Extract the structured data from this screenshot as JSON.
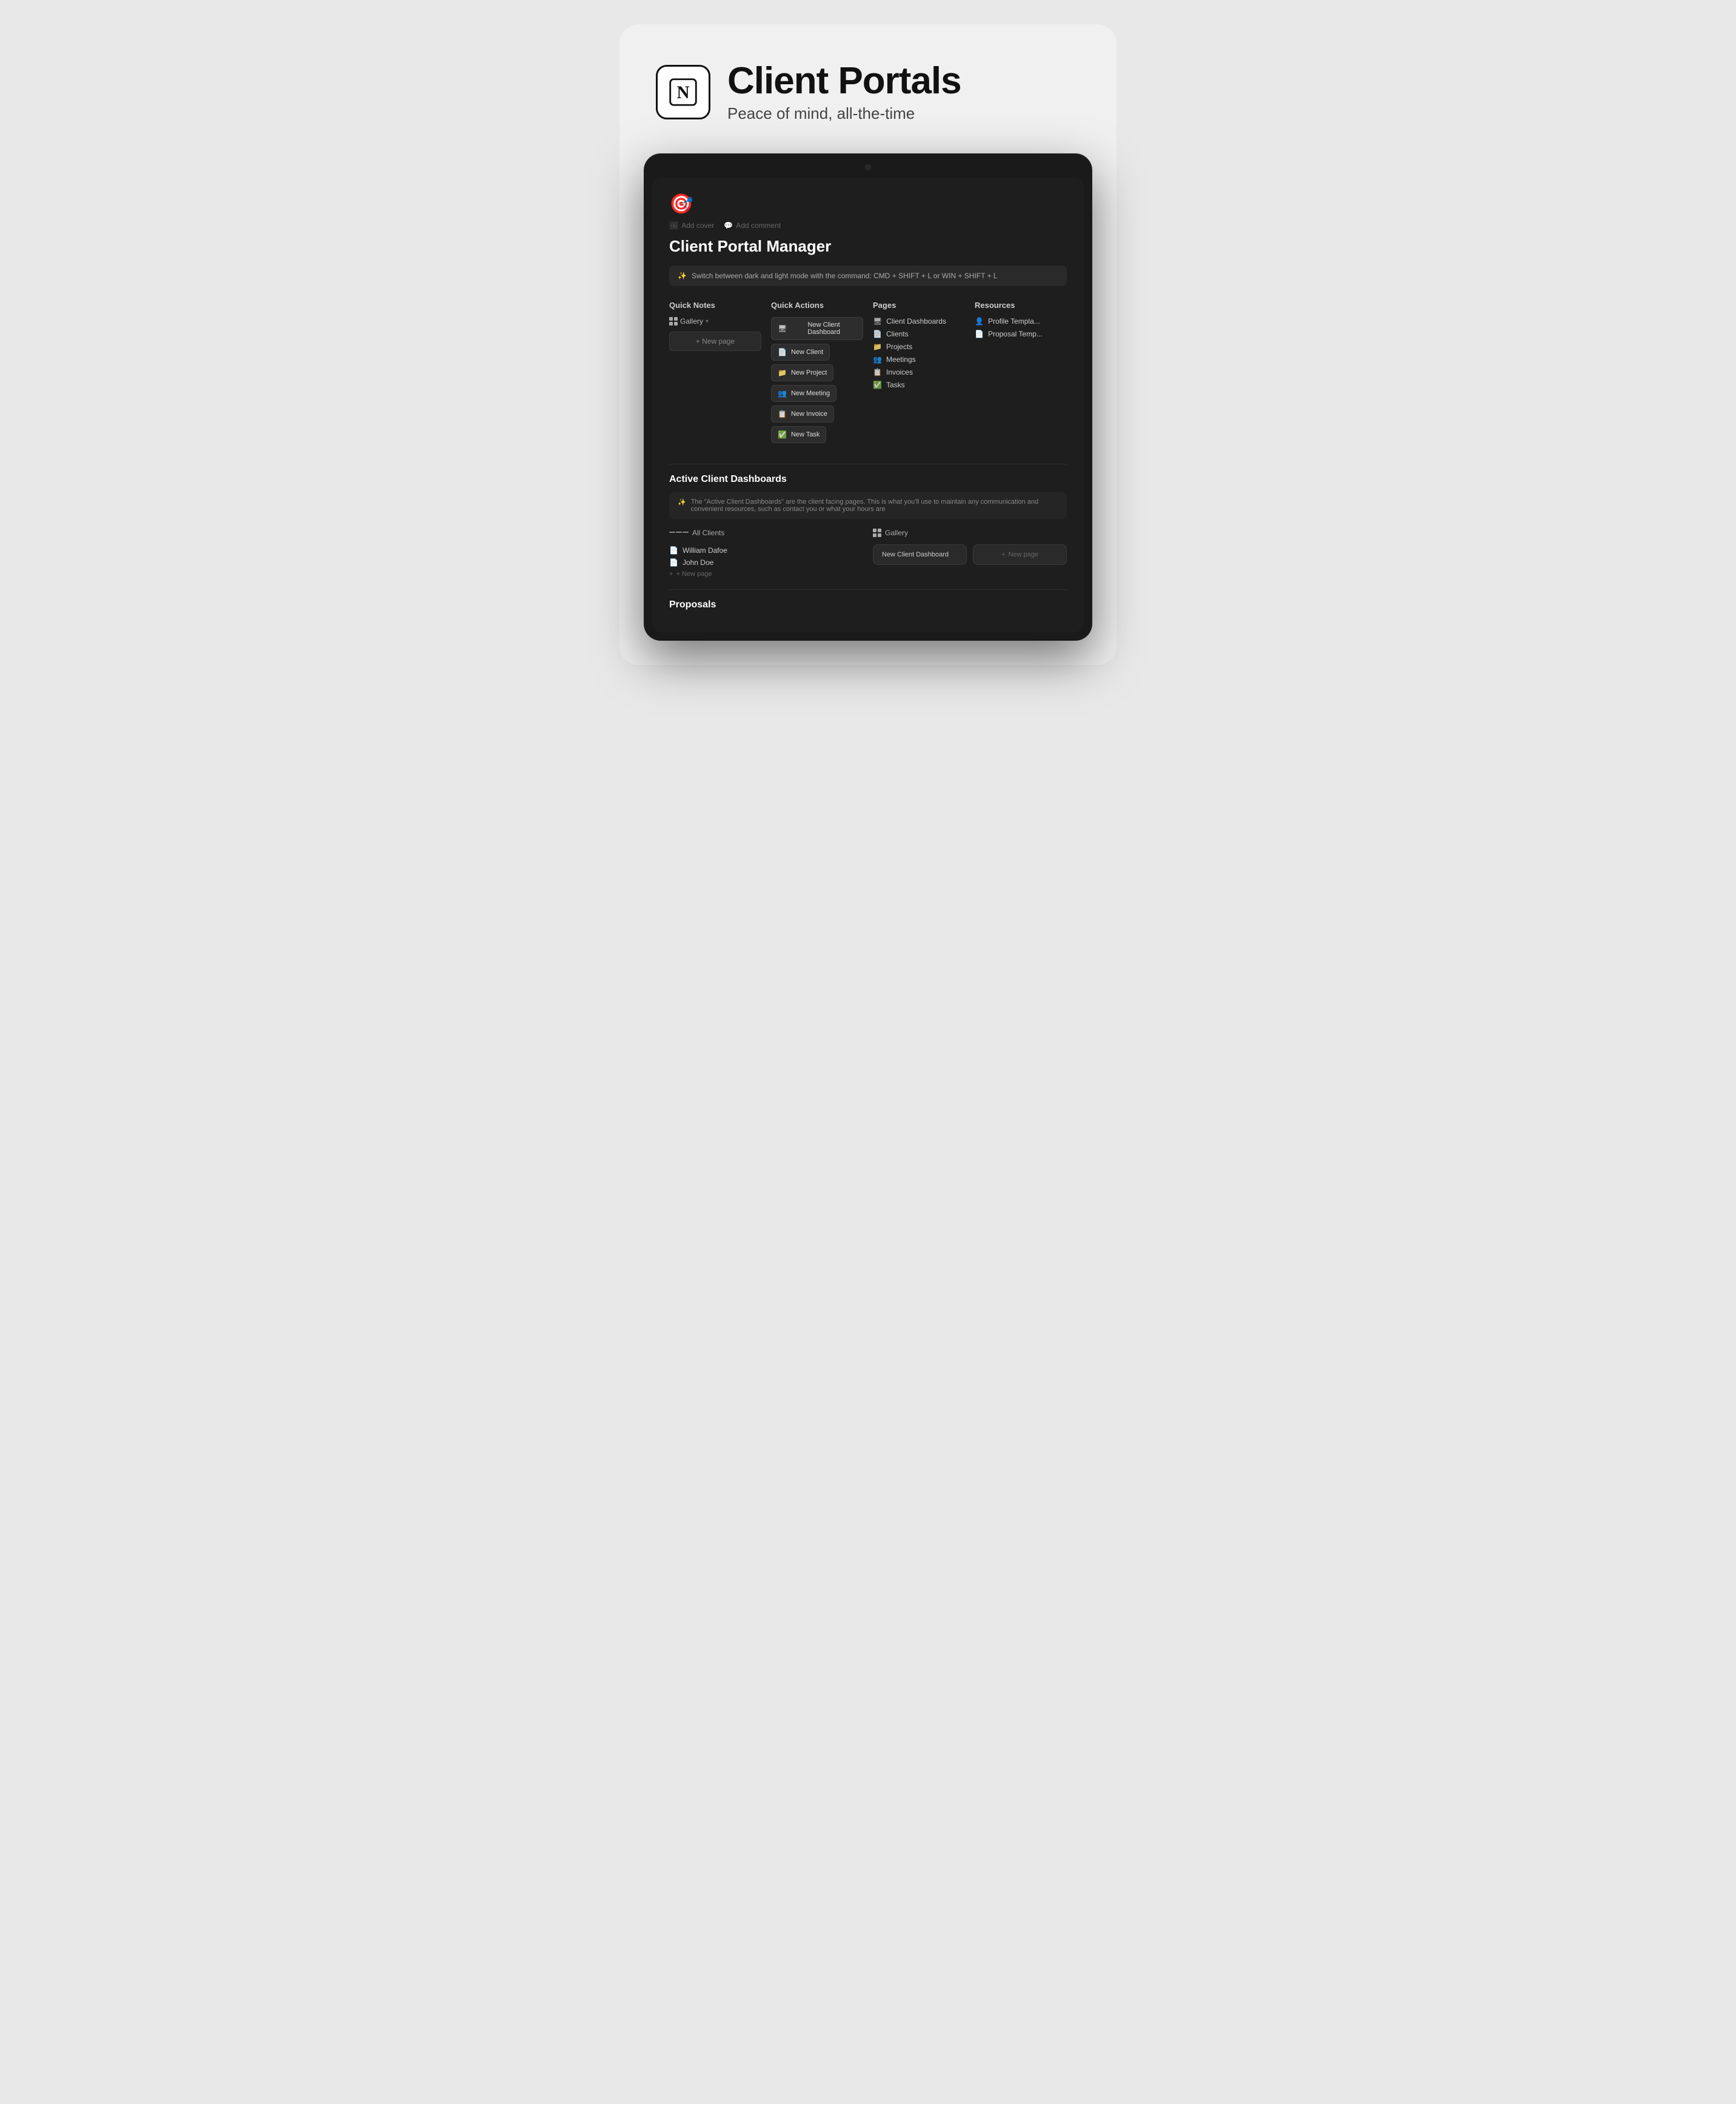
{
  "header": {
    "title": "Client Portals",
    "subtitle": "Peace of mind, all-the-time",
    "logo_alt": "Notion Logo"
  },
  "page": {
    "icon": "🎯",
    "add_cover": "Add cover",
    "add_comment": "Add comment",
    "title": "Client Portal Manager",
    "banner_icon": "✨",
    "banner_text": "Switch between dark and light mode with the command: CMD + SHIFT + L or WIN + SHIFT + L"
  },
  "quick_notes": {
    "heading": "Quick Notes",
    "gallery_label": "Gallery",
    "new_page_label": "+ New page"
  },
  "quick_actions": {
    "heading": "Quick Actions",
    "buttons": [
      {
        "label": "New Client Dashboard",
        "icon": "🖥"
      },
      {
        "label": "New Client",
        "icon": "📄"
      },
      {
        "label": "New Project",
        "icon": "📁"
      },
      {
        "label": "New Meeting",
        "icon": "👥"
      },
      {
        "label": "New Invoice",
        "icon": "📋"
      },
      {
        "label": "New Task",
        "icon": "✅"
      }
    ]
  },
  "pages": {
    "heading": "Pages",
    "items": [
      {
        "label": "Client Dashboards",
        "icon": "🖥"
      },
      {
        "label": "Clients",
        "icon": "📄"
      },
      {
        "label": "Projects",
        "icon": "📁"
      },
      {
        "label": "Meetings",
        "icon": "👥"
      },
      {
        "label": "Invoices",
        "icon": "📋"
      },
      {
        "label": "Tasks",
        "icon": "✅"
      }
    ]
  },
  "resources": {
    "heading": "Resources",
    "items": [
      {
        "label": "Profile Templa...",
        "icon": "👤"
      },
      {
        "label": "Proposal Temp...",
        "icon": "📄"
      }
    ]
  },
  "active_dashboards": {
    "heading": "Active Client Dashboards",
    "info_icon": "✨",
    "info_text": "The \"Active Client Dashboards\" are the client facing pages. This is what you'll use to maintain any communication and convenient resources, such as contact you or what your hours are",
    "list_view_label": "All Clients",
    "gallery_view_label": "Gallery",
    "clients": [
      {
        "label": "William Dafoe",
        "icon": "📄"
      },
      {
        "label": "John Doe",
        "icon": "📄"
      }
    ],
    "new_item_label": "+ New page",
    "gallery_cards": [
      {
        "label": "New Client Dashboard",
        "is_new": false
      },
      {
        "label": "+ New page",
        "is_new": true
      }
    ]
  },
  "proposals": {
    "heading": "Proposals"
  }
}
